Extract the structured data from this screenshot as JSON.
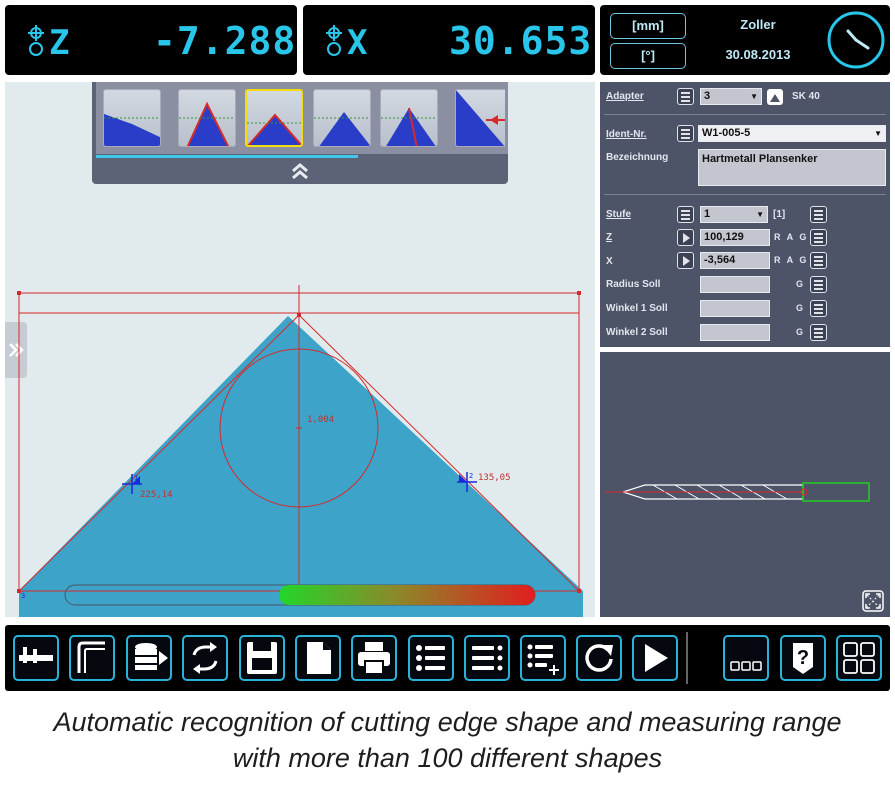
{
  "dro": {
    "z": {
      "axis": "Z",
      "value": "-7.288"
    },
    "x": {
      "axis": "X",
      "value": "30.653"
    }
  },
  "info": {
    "unit_mm": "[mm]",
    "unit_deg": "[°]",
    "name": "Zoller",
    "date": "30.08.2013"
  },
  "form": {
    "adapter": {
      "label": "Adapter",
      "value": "3",
      "extra": "SK 40"
    },
    "ident": {
      "label": "Ident-Nr.",
      "value": "W1-005-5"
    },
    "bezeichnung": {
      "label": "Bezeichnung",
      "value": "Hartmetall Plansenker"
    },
    "stufe": {
      "label": "Stufe",
      "value": "1",
      "extra": "[1]"
    },
    "z": {
      "label": "Z",
      "value": "100,129",
      "flags": "R A G"
    },
    "x": {
      "label": "X",
      "value": "-3,564",
      "flags": "R A G"
    },
    "radius": {
      "label": "Radius Soll",
      "value": "",
      "flags": "G"
    },
    "winkel1": {
      "label": "Winkel 1 Soll",
      "value": "",
      "flags": "G"
    },
    "winkel2": {
      "label": "Winkel 2 Soll",
      "value": "",
      "flags": "G"
    }
  },
  "measurement": {
    "radius_value": "1,004",
    "left_angle": "225,14",
    "right_angle": "135,05",
    "marker_left": "1",
    "marker_right": "2",
    "corner_label": "3"
  },
  "colors": {
    "accent": "#29c6ea",
    "tool_fill": "#3ea3c9",
    "measure_line": "#d42a2a",
    "selected_thumb": "#f2dd10"
  },
  "toolbar": {
    "icons": [
      "caliper-icon",
      "angle-icon",
      "database-icon",
      "swap-icon",
      "save-icon",
      "document-icon",
      "print-icon",
      "list-icon",
      "list-detail-icon",
      "list-add-icon",
      "refresh-icon",
      "play-icon",
      "layout-dots-icon",
      "help-icon",
      "grid-icon"
    ]
  },
  "caption": {
    "line1": "Automatic recognition of cutting edge shape and measuring range",
    "line2": "with more than 100 different shapes"
  }
}
